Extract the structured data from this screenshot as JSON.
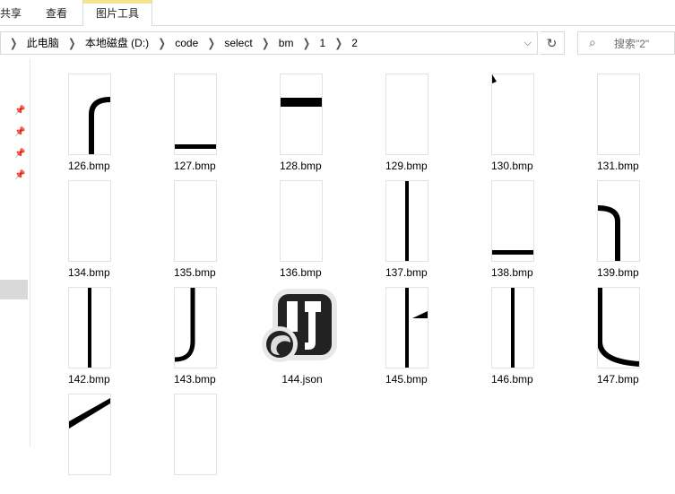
{
  "ribbon": {
    "tabs": [
      {
        "label": "共享"
      },
      {
        "label": "查看"
      },
      {
        "label": "图片工具"
      }
    ]
  },
  "address": {
    "crumbs": [
      "此电脑",
      "本地磁盘 (D:)",
      "code",
      "select",
      "bm",
      "1",
      "2"
    ]
  },
  "search": {
    "placeholder": "搜索\"2\""
  },
  "files": [
    {
      "name": "126.bmp",
      "shape": "curve-top-right"
    },
    {
      "name": "127.bmp",
      "shape": "hbar-bottom"
    },
    {
      "name": "128.bmp",
      "shape": "hbar-top"
    },
    {
      "name": "129.bmp",
      "shape": "blank"
    },
    {
      "name": "130.bmp",
      "shape": "corner-tick"
    },
    {
      "name": "131.bmp",
      "shape": "blank"
    },
    {
      "name": "134.bmp",
      "shape": "blank"
    },
    {
      "name": "135.bmp",
      "shape": "blank"
    },
    {
      "name": "136.bmp",
      "shape": "blank"
    },
    {
      "name": "137.bmp",
      "shape": "vbar-center"
    },
    {
      "name": "138.bmp",
      "shape": "hbar-low"
    },
    {
      "name": "139.bmp",
      "shape": "curve-top-left"
    },
    {
      "name": "142.bmp",
      "shape": "vbar-center"
    },
    {
      "name": "143.bmp",
      "shape": "curve-bottom-left"
    },
    {
      "name": "144.json",
      "shape": "json-icon"
    },
    {
      "name": "145.bmp",
      "shape": "vbar-flag"
    },
    {
      "name": "146.bmp",
      "shape": "vbar-center"
    },
    {
      "name": "147.bmp",
      "shape": "curve-bottom-right"
    },
    {
      "name": "",
      "shape": "diagonal"
    },
    {
      "name": "",
      "shape": "blank"
    }
  ]
}
